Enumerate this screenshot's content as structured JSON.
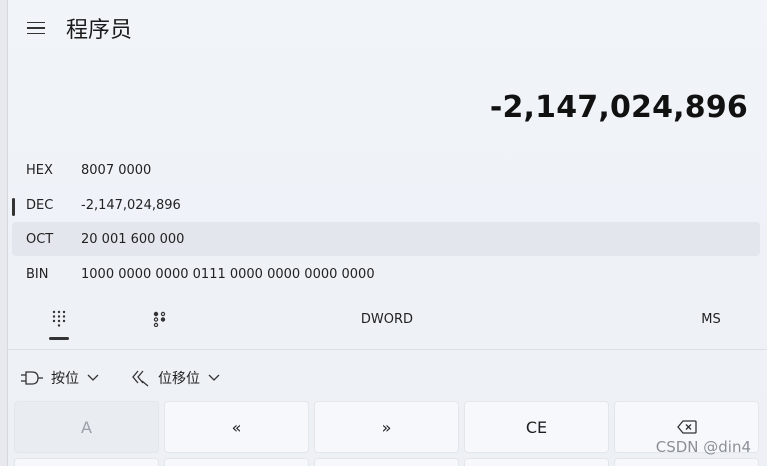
{
  "header": {
    "title": "程序员"
  },
  "display": {
    "value": "-2,147,024,896"
  },
  "radix": [
    {
      "label": "HEX",
      "value": "8007 0000"
    },
    {
      "label": "DEC",
      "value": "-2,147,024,896",
      "selected": true
    },
    {
      "label": "OCT",
      "value": "20 001 600 000"
    },
    {
      "label": "BIN",
      "value": "1000 0000 0000 0111 0000 0000 0000 0000"
    }
  ],
  "modes": {
    "word_size": "DWORD",
    "memory_store": "MS"
  },
  "bitops": {
    "bitwise": "按位",
    "bitshift": "位移位"
  },
  "keys": {
    "a": "A",
    "lshift": "«",
    "rshift": "»",
    "ce": "CE",
    "backspace_icon": "backspace-icon"
  },
  "watermark": "CSDN @din4",
  "colors": {
    "background": "#eef1f6",
    "hover_row": "#e3e6ec",
    "key": "#f7f8fb",
    "key_disabled": "#e9ecf1"
  }
}
